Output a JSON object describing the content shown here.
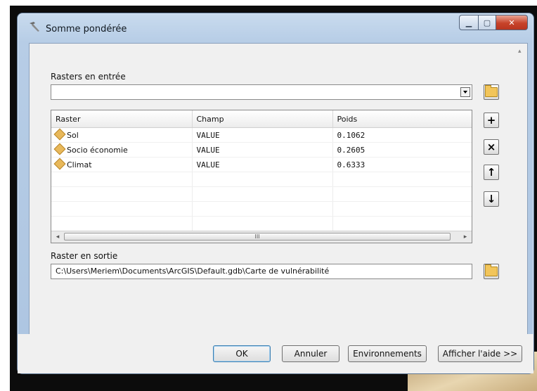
{
  "window": {
    "title": "Somme pondérée"
  },
  "input_rasters": {
    "label": "Rasters en entrée",
    "value": ""
  },
  "table": {
    "columns": [
      "Raster",
      "Champ",
      "Poids"
    ],
    "rows": [
      {
        "raster": "Sol",
        "champ": "VALUE",
        "poids": "0.1062"
      },
      {
        "raster": "Socio économie",
        "champ": "VALUE",
        "poids": "0.2605"
      },
      {
        "raster": "Climat",
        "champ": "VALUE",
        "poids": "0.6333"
      }
    ],
    "scroll_thumb_glyph": "III"
  },
  "side_buttons": {
    "add": "+",
    "remove": "×",
    "up": "↑",
    "down": "↓"
  },
  "output_raster": {
    "label": "Raster en sortie",
    "value": "C:\\Users\\Meriem\\Documents\\ArcGIS\\Default.gdb\\Carte de vulnérabilité"
  },
  "buttons": {
    "ok": "OK",
    "cancel": "Annuler",
    "environments": "Environnements",
    "help": "Afficher l'aide >>"
  },
  "colors": {
    "raster_icon": "#e8b85a",
    "folder_icon": "#f2c55a",
    "close_button": "#c7432a"
  }
}
